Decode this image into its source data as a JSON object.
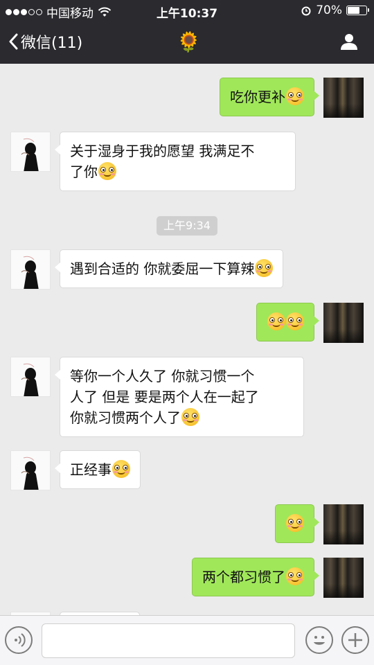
{
  "status_bar": {
    "carrier": "中国移动",
    "time": "上午10:37",
    "battery_percent": "70%",
    "battery_level": 0.7,
    "signal_dots_filled": 3,
    "signal_dots_total": 5
  },
  "nav": {
    "back_label": "微信(11)",
    "title_icon": "sunflower-icon",
    "right_icon": "profile-icon"
  },
  "messages": [
    {
      "sender": "me",
      "text": "吃你更补",
      "emoji_count": 1
    },
    {
      "sender": "other",
      "lines": [
        "关于湿身于我的愿望 我满足不",
        "了你"
      ],
      "emoji_count": 1
    },
    {
      "sender": "other",
      "text": "遇到合适的 你就委屈一下算辣",
      "emoji_count": 1
    },
    {
      "sender": "me",
      "text": "",
      "emoji_count": 2
    },
    {
      "sender": "other",
      "lines": [
        "等你一个人久了 你就习惯一个",
        "人了 但是 要是两个人在一起了",
        "你就习惯两个人了"
      ],
      "emoji_count": 1
    },
    {
      "sender": "other",
      "text": "正经事",
      "emoji_count": 1
    },
    {
      "sender": "me",
      "text": "",
      "emoji_count": 1
    },
    {
      "sender": "me",
      "text": "两个都习惯了",
      "emoji_count": 1
    }
  ],
  "timestamp": "上午9:34",
  "colors": {
    "header_bg": "#2a2a2f",
    "chat_bg": "#ebebeb",
    "my_bubble": "#a0e75a",
    "their_bubble": "#ffffff"
  },
  "input": {
    "voice_icon": "voice-icon",
    "emoji_icon": "emoji-icon",
    "plus_icon": "plus-icon"
  }
}
